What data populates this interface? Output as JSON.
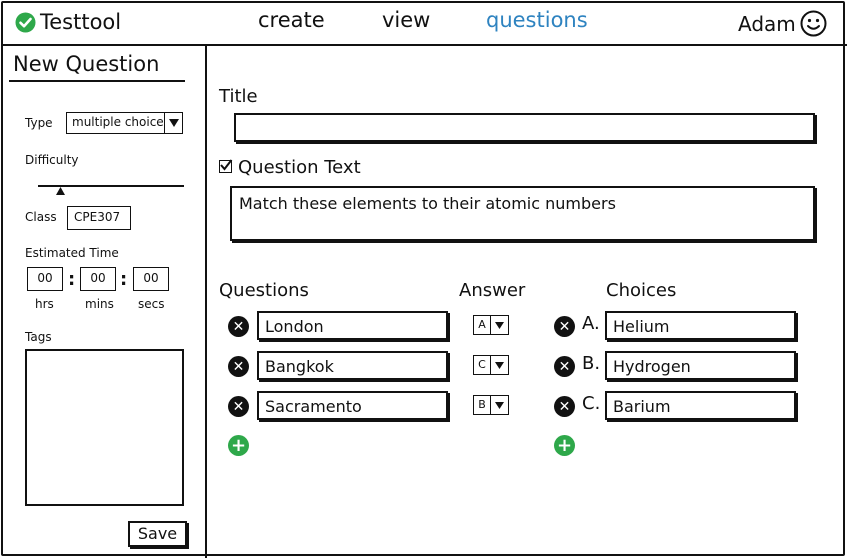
{
  "app": {
    "name": "Testtool"
  },
  "nav": {
    "create": "create",
    "view": "view",
    "questions": "questions"
  },
  "user": {
    "name": "Adam"
  },
  "sidebar": {
    "title": "New Question",
    "type_label": "Type",
    "type_value": "multiple choice",
    "difficulty_label": "Difficulty",
    "difficulty_value": 0.13,
    "class_label": "Class",
    "class_value": "CPE307",
    "estimated_time_label": "Estimated Time",
    "time": {
      "hrs": "00",
      "mins": "00",
      "secs": "00"
    },
    "time_units": {
      "hrs": "hrs",
      "mins": "mins",
      "secs": "secs"
    },
    "tags_label": "Tags",
    "save_label": "Save"
  },
  "main": {
    "title_label": "Title",
    "title_value": "",
    "question_text_label": "Question Text",
    "question_text_checked": true,
    "question_text_value": "Match these elements to their atomic numbers",
    "questions_header": "Questions",
    "answer_header": "Answer",
    "choices_header": "Choices",
    "questions": [
      "London",
      "Bangkok",
      "Sacramento"
    ],
    "answers": [
      "A",
      "C",
      "B"
    ],
    "choice_letters": [
      "A.",
      "B.",
      "C."
    ],
    "choices": [
      "Helium",
      "Hydrogen",
      "Barium"
    ]
  },
  "colors": {
    "accent": "#2e83c0",
    "add": "#2ea84a",
    "ink": "#111111"
  },
  "icons": {
    "logo": "check-circle-icon",
    "user": "smiley-icon",
    "remove": "remove-circle-icon",
    "add": "add-circle-icon",
    "dropdown": "caret-down-icon"
  }
}
